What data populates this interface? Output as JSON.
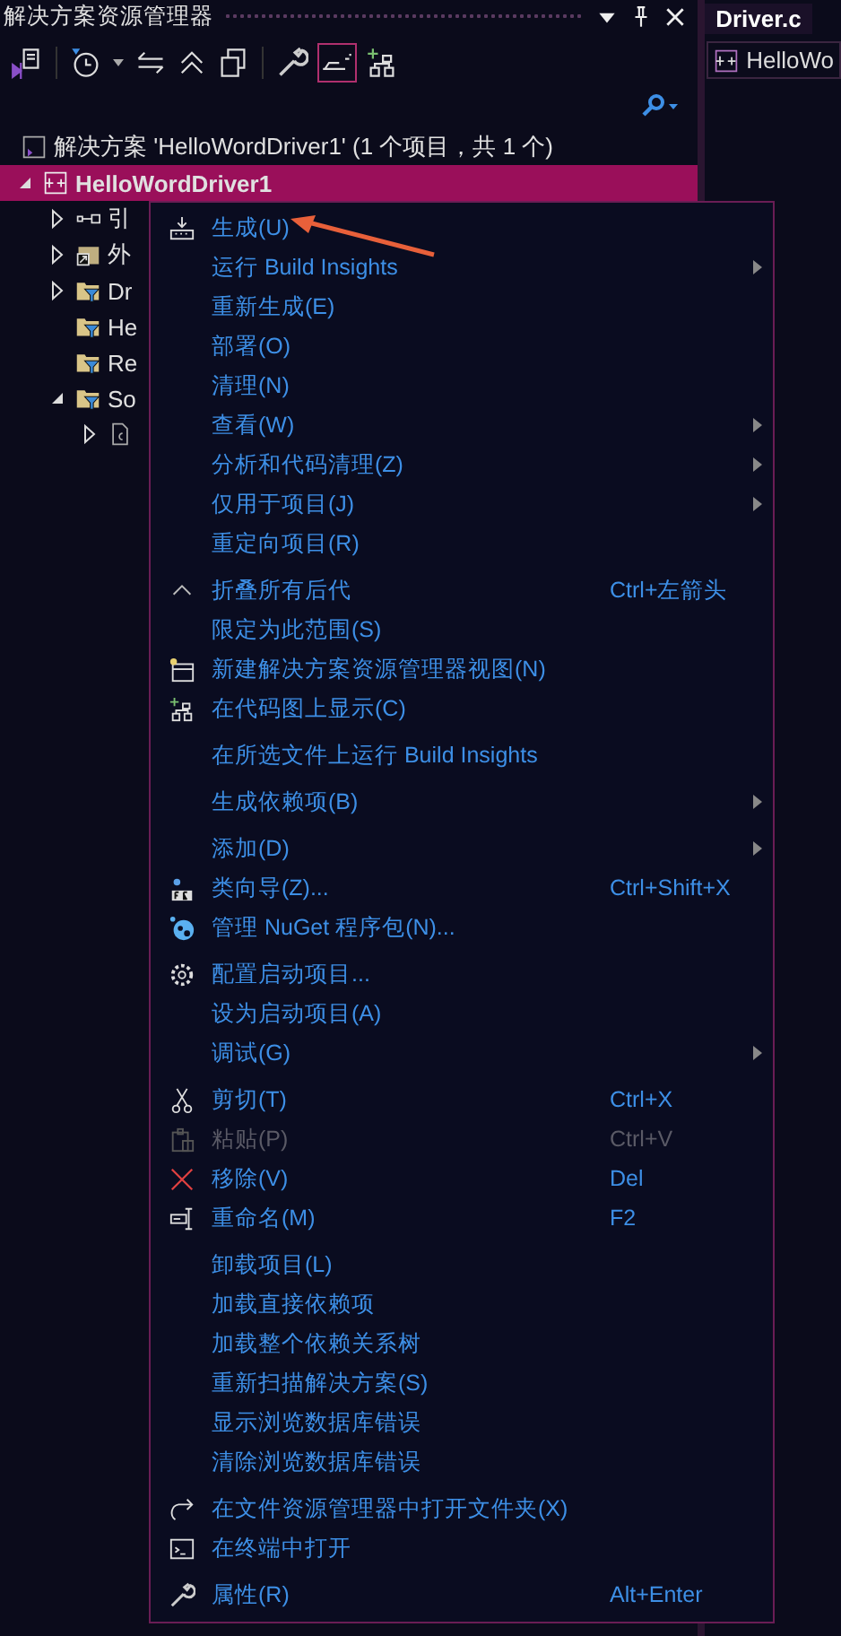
{
  "panel": {
    "title": "解决方案资源管理器"
  },
  "solution": {
    "label": "解决方案 'HelloWordDriver1' (1 个项目，共 1 个)"
  },
  "tree": [
    {
      "label": "HelloWordDriver1",
      "kind": "project",
      "selected": true,
      "expanded": true,
      "children": [
        {
          "label": "引",
          "kind": "references",
          "selected": false,
          "expanded": false
        },
        {
          "label": "外",
          "kind": "external",
          "selected": false,
          "expanded": false
        },
        {
          "label": "Dr",
          "kind": "filter",
          "selected": false,
          "expanded": false
        },
        {
          "label": "He",
          "kind": "filter",
          "selected": false
        },
        {
          "label": "Re",
          "kind": "filter",
          "selected": false
        },
        {
          "label": "So",
          "kind": "filter",
          "selected": false,
          "expanded": true,
          "children": [
            {
              "kind": "file",
              "selected": false,
              "expanded": false
            }
          ]
        }
      ]
    }
  ],
  "editor": {
    "tab": "Driver.c",
    "nav": "HelloWo"
  },
  "context_menu": {
    "groups": [
      [
        {
          "label": "生成(U)",
          "kind": "build",
          "submenu": false,
          "disabled": false
        },
        {
          "label": "运行 Build Insights",
          "submenu": true,
          "disabled": false
        },
        {
          "label": "重新生成(E)",
          "submenu": false,
          "disabled": false
        },
        {
          "label": "部署(O)",
          "submenu": false,
          "disabled": false
        },
        {
          "label": "清理(N)",
          "submenu": false,
          "disabled": false
        },
        {
          "label": "查看(W)",
          "submenu": true,
          "disabled": false
        },
        {
          "label": "分析和代码清理(Z)",
          "submenu": true,
          "disabled": false
        },
        {
          "label": "仅用于项目(J)",
          "submenu": true,
          "disabled": false
        },
        {
          "label": "重定向项目(R)",
          "submenu": false,
          "disabled": false
        }
      ],
      [
        {
          "label": "折叠所有后代",
          "shortcut": "Ctrl+左箭头",
          "kind": "collapse",
          "submenu": false,
          "disabled": false
        },
        {
          "label": "限定为此范围(S)",
          "submenu": false,
          "disabled": false
        },
        {
          "label": "新建解决方案资源管理器视图(N)",
          "kind": "new-view",
          "submenu": false,
          "disabled": false
        },
        {
          "label": "在代码图上显示(C)",
          "kind": "code-map",
          "submenu": false,
          "disabled": false
        }
      ],
      [
        {
          "label": "在所选文件上运行 Build Insights",
          "submenu": false,
          "disabled": false
        }
      ],
      [
        {
          "label": "生成依赖项(B)",
          "submenu": true,
          "disabled": false
        }
      ],
      [
        {
          "label": "添加(D)",
          "submenu": true,
          "disabled": false
        },
        {
          "label": "类向导(Z)...",
          "shortcut": "Ctrl+Shift+X",
          "kind": "class-wizard",
          "submenu": false,
          "disabled": false
        },
        {
          "label": "管理 NuGet 程序包(N)...",
          "kind": "nuget",
          "submenu": false,
          "disabled": false
        }
      ],
      [
        {
          "label": "配置启动项目...",
          "kind": "gear",
          "submenu": false,
          "disabled": false
        },
        {
          "label": "设为启动项目(A)",
          "submenu": false,
          "disabled": false
        },
        {
          "label": "调试(G)",
          "submenu": true,
          "disabled": false
        }
      ],
      [
        {
          "label": "剪切(T)",
          "shortcut": "Ctrl+X",
          "kind": "cut",
          "submenu": false,
          "disabled": false
        },
        {
          "label": "粘贴(P)",
          "shortcut": "Ctrl+V",
          "kind": "paste",
          "submenu": false,
          "disabled": true
        },
        {
          "label": "移除(V)",
          "shortcut": "Del",
          "kind": "remove",
          "submenu": false,
          "disabled": false
        },
        {
          "label": "重命名(M)",
          "shortcut": "F2",
          "kind": "rename",
          "submenu": false,
          "disabled": false
        }
      ],
      [
        {
          "label": "卸载项目(L)",
          "submenu": false,
          "disabled": false
        },
        {
          "label": "加载直接依赖项",
          "submenu": false,
          "disabled": false
        },
        {
          "label": "加载整个依赖关系树",
          "submenu": false,
          "disabled": false
        },
        {
          "label": "重新扫描解决方案(S)",
          "submenu": false,
          "disabled": false
        },
        {
          "label": "显示浏览数据库错误",
          "submenu": false,
          "disabled": false
        },
        {
          "label": "清除浏览数据库错误",
          "submenu": false,
          "disabled": false
        }
      ],
      [
        {
          "label": "在文件资源管理器中打开文件夹(X)",
          "kind": "open-folder",
          "submenu": false,
          "disabled": false
        },
        {
          "label": "在终端中打开",
          "kind": "terminal",
          "submenu": false,
          "disabled": false
        }
      ],
      [
        {
          "label": "属性(R)",
          "shortcut": "Alt+Enter",
          "kind": "wrench",
          "submenu": false,
          "disabled": false
        }
      ]
    ]
  }
}
